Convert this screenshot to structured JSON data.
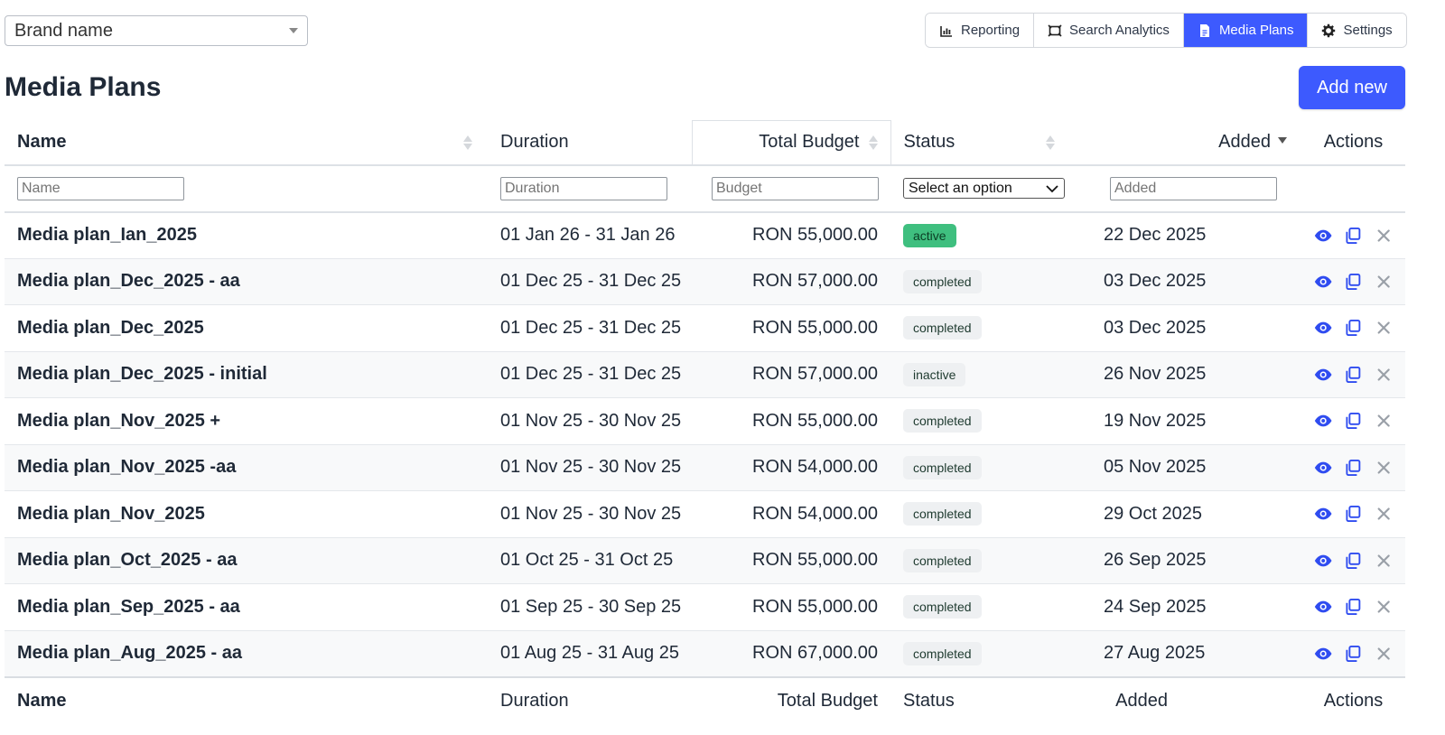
{
  "brand_select": {
    "value": "Brand name"
  },
  "nav": {
    "tabs": [
      {
        "label": "Reporting",
        "icon": "bar-chart-icon",
        "active": false
      },
      {
        "label": "Search Analytics",
        "icon": "analytics-icon",
        "active": false
      },
      {
        "label": "Media Plans",
        "icon": "document-icon",
        "active": true
      },
      {
        "label": "Settings",
        "icon": "gear-icon",
        "active": false
      }
    ]
  },
  "page": {
    "title": "Media Plans",
    "add_button": "Add new"
  },
  "table": {
    "headers": {
      "name": "Name",
      "duration": "Duration",
      "budget": "Total Budget",
      "status": "Status",
      "added": "Added",
      "actions": "Actions"
    },
    "filters": {
      "name": "Name",
      "duration": "Duration",
      "budget": "Budget",
      "status": "Select an option",
      "added": "Added"
    },
    "rows": [
      {
        "name": "Media plan_Ian_2025",
        "duration": "01 Jan 26 - 31 Jan 26",
        "budget": "RON 55,000.00",
        "status": "active",
        "added": "22 Dec 2025"
      },
      {
        "name": "Media plan_Dec_2025 - aa",
        "duration": "01 Dec 25 - 31 Dec 25",
        "budget": "RON 57,000.00",
        "status": "completed",
        "added": "03 Dec 2025"
      },
      {
        "name": "Media plan_Dec_2025",
        "duration": "01 Dec 25 - 31 Dec 25",
        "budget": "RON 55,000.00",
        "status": "completed",
        "added": "03 Dec 2025"
      },
      {
        "name": "Media plan_Dec_2025 - initial",
        "duration": "01 Dec 25 - 31 Dec 25",
        "budget": "RON 57,000.00",
        "status": "inactive",
        "added": "26 Nov 2025"
      },
      {
        "name": "Media plan_Nov_2025 +",
        "duration": "01 Nov 25 - 30 Nov 25",
        "budget": "RON 55,000.00",
        "status": "completed",
        "added": "19 Nov 2025"
      },
      {
        "name": "Media plan_Nov_2025 -aa",
        "duration": "01 Nov 25 - 30 Nov 25",
        "budget": "RON 54,000.00",
        "status": "completed",
        "added": "05 Nov 2025"
      },
      {
        "name": "Media plan_Nov_2025",
        "duration": "01 Nov 25 - 30 Nov 25",
        "budget": "RON 54,000.00",
        "status": "completed",
        "added": "29 Oct 2025"
      },
      {
        "name": "Media plan_Oct_2025 - aa",
        "duration": "01 Oct 25 - 31 Oct 25",
        "budget": "RON 55,000.00",
        "status": "completed",
        "added": "26 Sep 2025"
      },
      {
        "name": "Media plan_Sep_2025 - aa",
        "duration": "01 Sep 25 - 30 Sep 25",
        "budget": "RON 55,000.00",
        "status": "completed",
        "added": "24 Sep 2025"
      },
      {
        "name": "Media plan_Aug_2025 - aa",
        "duration": "01 Aug 25 - 31 Aug 25",
        "budget": "RON 67,000.00",
        "status": "completed",
        "added": "27 Aug 2025"
      }
    ]
  },
  "colors": {
    "accent": "#3d5afe",
    "active_badge": "#3fbf7f",
    "badge_bg": "#eef0f2",
    "action_icon": "#2f4cf0",
    "delete_icon": "#9aa0a8"
  },
  "action_icons": [
    "eye-icon",
    "copy-icon",
    "close-icon"
  ]
}
